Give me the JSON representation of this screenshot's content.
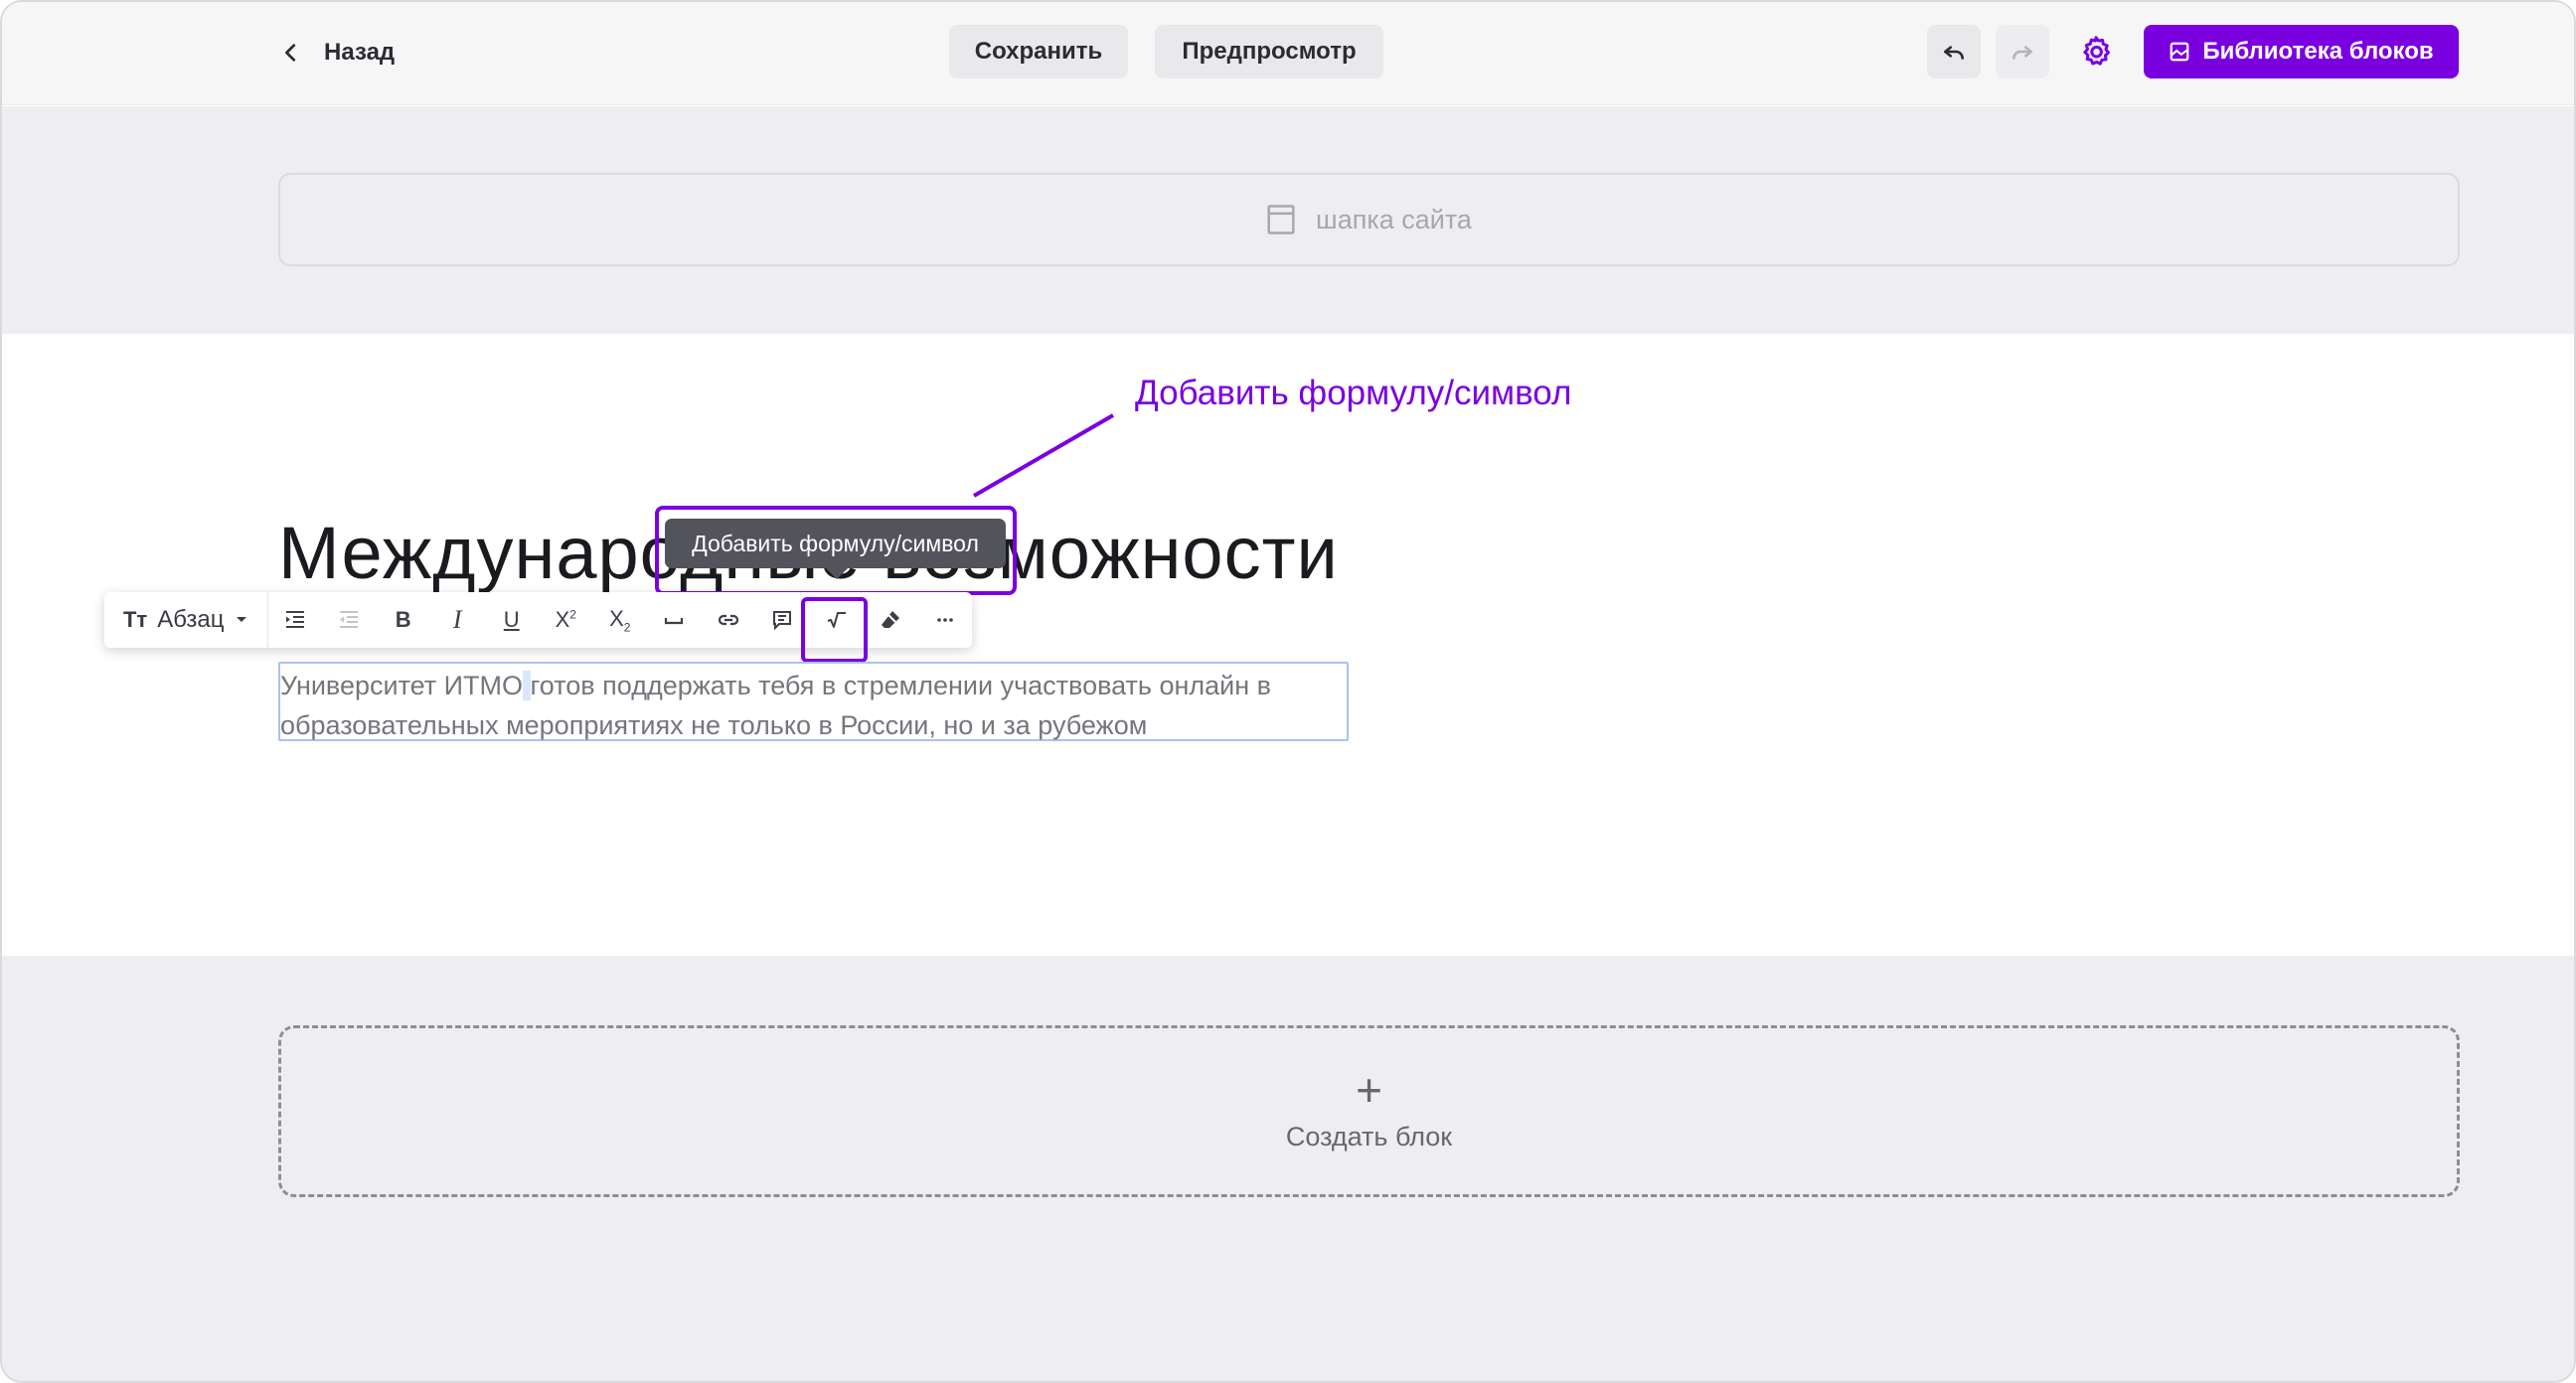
{
  "topbar": {
    "back_label": "Назад",
    "save_label": "Сохранить",
    "preview_label": "Предпросмотр",
    "library_label": "Библиотека блоков"
  },
  "header_block": {
    "label": "шапка сайта"
  },
  "annotation": {
    "callout": "Добавить формулу/символ"
  },
  "tooltip": {
    "text": "Добавить формулу/символ"
  },
  "page": {
    "title": "Международные возможности",
    "text_line1_before": "Университет ИТМО",
    "text_line1_after": "готов поддержать тебя в стремлении участвовать онлайн в",
    "text_line2": "образовательных мероприятиях не только в России, но и за рубежом"
  },
  "toolbar": {
    "paragraph_icon": "Tт",
    "paragraph_label": "Абзац",
    "buttons": [
      "indent-icon",
      "outdent-icon",
      "bold-icon",
      "italic-icon",
      "underline-icon",
      "superscript-icon",
      "subscript-icon",
      "nbsp-icon",
      "link-icon",
      "comment-icon",
      "formula-icon",
      "eraser-icon",
      "more-icon"
    ]
  },
  "footer": {
    "create_plus": "+",
    "create_label": "Создать блок"
  },
  "colors": {
    "accent": "#7b00e0",
    "tooltip_bg": "#53535b",
    "text": "#1a1a1f"
  }
}
